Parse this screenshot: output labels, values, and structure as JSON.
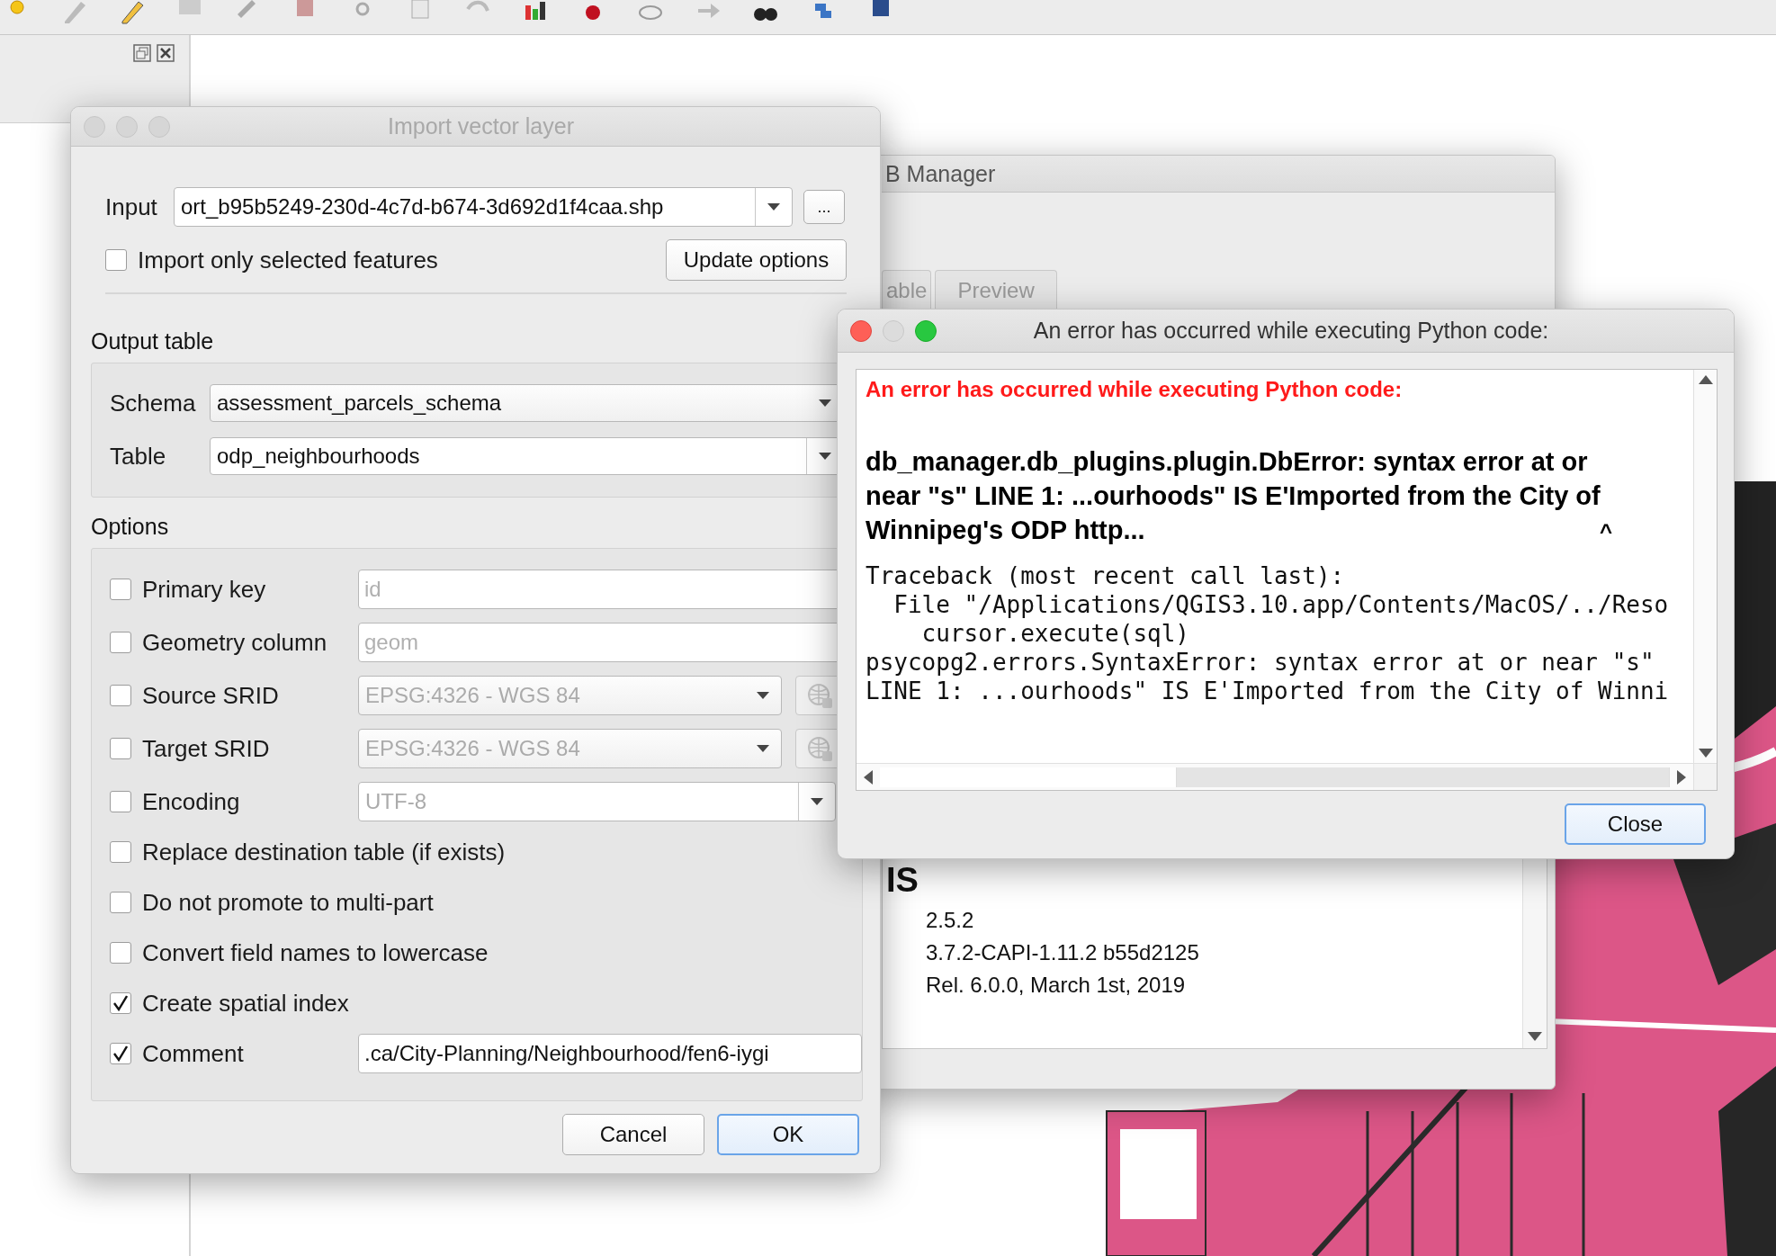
{
  "db_manager": {
    "title": "B Manager",
    "tabs": [
      {
        "label": "able",
        "selected": false
      },
      {
        "label": "Preview",
        "selected": false
      }
    ],
    "heading": "IS",
    "info_lines": [
      "2.5.2",
      "3.7.2-CAPI-1.11.2 b55d2125",
      "Rel. 6.0.0, March 1st, 2019"
    ]
  },
  "import_dialog": {
    "title": "Import vector layer",
    "active": false,
    "input": {
      "label": "Input",
      "value": "ort_b95b5249-230d-4c7d-b674-3d692d1f4caa.shp",
      "browse": "..."
    },
    "selected_only": {
      "label": "Import only selected features",
      "checked": false
    },
    "update_button": "Update options",
    "output_table": {
      "title": "Output table",
      "schema": {
        "label": "Schema",
        "value": "assessment_parcels_schema"
      },
      "table": {
        "label": "Table",
        "value": "odp_neighbourhoods"
      }
    },
    "options": {
      "title": "Options",
      "items": [
        {
          "kind": "text",
          "label": "Primary key",
          "checked": false,
          "value": "id"
        },
        {
          "kind": "text",
          "label": "Geometry column",
          "checked": false,
          "value": "geom"
        },
        {
          "kind": "crs",
          "label": "Source SRID",
          "checked": false,
          "value": "EPSG:4326 - WGS 84"
        },
        {
          "kind": "crs",
          "label": "Target SRID",
          "checked": false,
          "value": "EPSG:4326 - WGS 84"
        },
        {
          "kind": "combo",
          "label": "Encoding",
          "checked": false,
          "value": "UTF-8"
        },
        {
          "kind": "check",
          "label": "Replace destination table (if exists)",
          "checked": false
        },
        {
          "kind": "check",
          "label": "Do not promote to multi-part",
          "checked": false
        },
        {
          "kind": "check",
          "label": "Convert field names to lowercase",
          "checked": false
        },
        {
          "kind": "check",
          "label": "Create spatial index",
          "checked": true
        },
        {
          "kind": "text",
          "label": "Comment",
          "checked": true,
          "value": ".ca/City-Planning/Neighbourhood/fen6-iygi"
        }
      ]
    },
    "buttons": [
      {
        "label": "Cancel",
        "default": false
      },
      {
        "label": "OK",
        "default": true
      }
    ]
  },
  "error_dialog": {
    "title": "An error has occurred while executing Python code:",
    "active": true,
    "message_title": "An error has occurred while executing Python code:",
    "error_lines": [
      "db_manager.db_plugins.plugin.DbError: syntax error at or",
      "near \"s\" LINE 1: ...ourhoods\" IS E'Imported from the City of",
      "Winnipeg's ODP http..."
    ],
    "caret": "^",
    "traceback": [
      "Traceback (most recent call last):",
      "  File \"/Applications/QGIS3.10.app/Contents/MacOS/../Reso",
      "    cursor.execute(sql)",
      "psycopg2.errors.SyntaxError: syntax error at or near \"s\"",
      "LINE 1: ...ourhoods\" IS E'Imported from the City of Winni"
    ],
    "close_button": {
      "label": "Close",
      "default": true
    }
  }
}
